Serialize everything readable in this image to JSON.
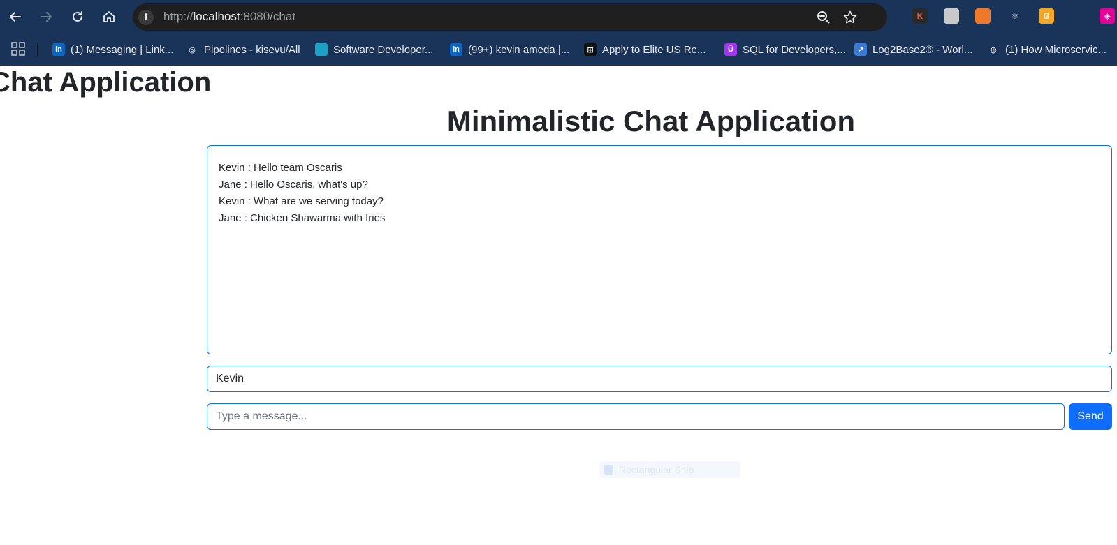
{
  "browser": {
    "url_prefix": "http://",
    "url_host": "localhost",
    "url_rest": ":8080/chat",
    "info_glyph": "i",
    "extensions": [
      {
        "icon": "k-extension-icon",
        "glyph": "K",
        "color": "#2a2a2a",
        "text_color": "#e55a3a"
      },
      {
        "icon": "puzzle-extension-icon",
        "glyph": "",
        "color": "#c9c9c9",
        "text_color": "#fff"
      },
      {
        "icon": "orange-extension-icon",
        "glyph": "",
        "color": "#f0782a",
        "text_color": "#fff"
      },
      {
        "icon": "react-extension-icon",
        "glyph": "⚛",
        "color": "transparent",
        "text_color": "#e8eaed"
      },
      {
        "icon": "g-extension-icon",
        "glyph": "G",
        "color": "#f5a623",
        "text_color": "#fff"
      },
      {
        "icon": "extensions-puzzle-icon",
        "glyph": "",
        "color": "transparent",
        "text_color": "#e8eaed"
      },
      {
        "icon": "graphql-extension-icon",
        "glyph": "◈",
        "color": "#e10098",
        "text_color": "#fff"
      }
    ]
  },
  "bookmarks": [
    {
      "label": "(1) Messaging | Link...",
      "icon": "linkedin-icon",
      "glyph": "in",
      "color": "#0a66c2"
    },
    {
      "label": "Pipelines - kisevu/All",
      "icon": "azure-pipelines-icon",
      "glyph": "◎",
      "color": "transparent"
    },
    {
      "label": "Software Developer...",
      "icon": "circle-site-icon",
      "glyph": "",
      "color": "#1ba1c6"
    },
    {
      "label": "(99+) kevin ameda |...",
      "icon": "linkedin-icon",
      "glyph": "in",
      "color": "#0a66c2"
    },
    {
      "label": "Apply to Elite US Re...",
      "icon": "dark-site-icon",
      "glyph": "⊞",
      "color": "#111111"
    },
    {
      "label": "SQL for Developers,...",
      "icon": "udemy-icon",
      "glyph": "Ū",
      "color": "#a435f0"
    },
    {
      "label": "Log2Base2® - Worl...",
      "icon": "log2base2-icon",
      "glyph": "↗",
      "color": "#3a7bd5"
    },
    {
      "label": "(1) How Microservic...",
      "icon": "globe-icon",
      "glyph": "◍",
      "color": "transparent"
    }
  ],
  "page": {
    "left_heading": "Chat Application",
    "main_heading": "Minimalistic Chat Application",
    "messages": [
      "Kevin : Hello team Oscaris",
      "Jane : Hello Oscaris, what's up?",
      "Kevin : What are we serving today?",
      "Jane : Chicken Shawarma with fries"
    ],
    "name_value": "Kevin",
    "message_placeholder": "Type a message...",
    "send_label": "Send",
    "snip_label": "Rectangular Snip"
  },
  "colors": {
    "chrome_bg": "#1a3358",
    "accent": "#0d6efd",
    "text": "#212529"
  }
}
